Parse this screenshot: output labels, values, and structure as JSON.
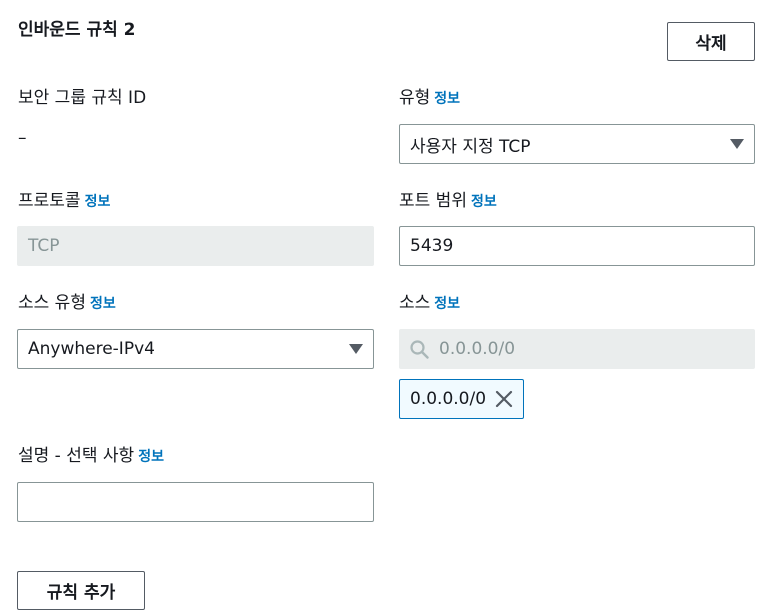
{
  "rule": {
    "title": "인바운드 규칙 2",
    "delete_label": "삭제"
  },
  "info_link": "정보",
  "security_group_rule_id": {
    "label": "보안 그룹 규칙 ID",
    "value": "–"
  },
  "type": {
    "label": "유형",
    "value": "사용자 지정 TCP"
  },
  "protocol": {
    "label": "프로토콜",
    "value": "TCP"
  },
  "port_range": {
    "label": "포트 범위",
    "value": "5439"
  },
  "source_type": {
    "label": "소스 유형",
    "value": "Anywhere-IPv4"
  },
  "source": {
    "label": "소스",
    "placeholder": "0.0.0.0/0",
    "tokens": [
      "0.0.0.0/0"
    ]
  },
  "description": {
    "label": "설명 - 선택 사항",
    "value": ""
  },
  "add_rule_label": "규칙 추가",
  "colors": {
    "link": "#0073bb",
    "text": "#16191f",
    "border": "#879596",
    "disabled_bg": "#eaeded",
    "token_border": "#0073bb",
    "token_bg": "#f1faff"
  },
  "icons": [
    "chevron-down-icon",
    "search-icon",
    "close-icon"
  ]
}
